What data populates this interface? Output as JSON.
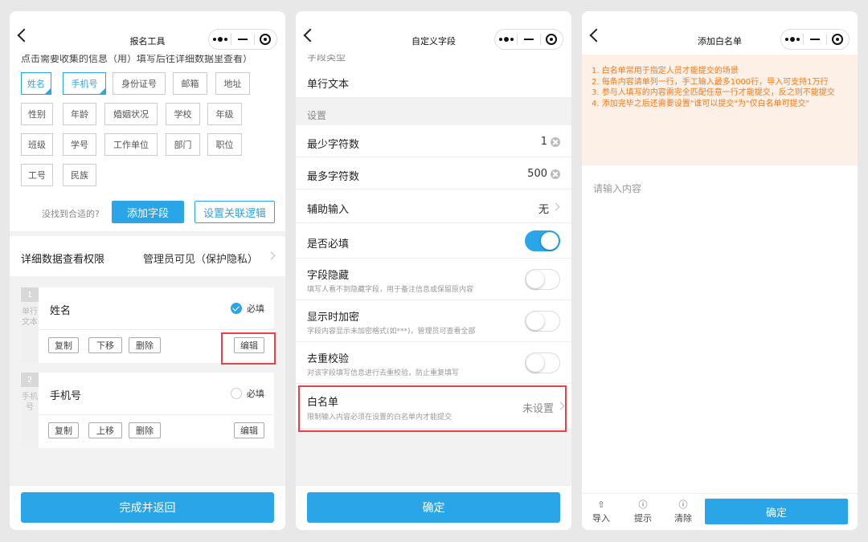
{
  "phone1": {
    "title": "报名工具",
    "cut_hint": "点击需要收集的信息（用）填写后往详细数据里查看）",
    "chips": [
      "姓名",
      "手机号",
      "身份证号",
      "邮箱",
      "地址",
      "性别",
      "年龄",
      "婚姻状况",
      "学校",
      "年级",
      "班级",
      "学号",
      "工作单位",
      "部门",
      "职位",
      "工号",
      "民族"
    ],
    "no_find": "没找到合适的?",
    "add_field": "添加字段",
    "set_logic": "设置关联逻辑",
    "perm_label": "详细数据查看权限",
    "perm_value": "管理员可见（保护隐私）",
    "fields": [
      {
        "num": "1",
        "type": "单行文本",
        "title": "姓名",
        "required": "必填",
        "actions": [
          "复制",
          "下移",
          "删除"
        ],
        "edit": "编辑"
      },
      {
        "num": "2",
        "type": "手机号",
        "title": "手机号",
        "required": "必填",
        "actions": [
          "复制",
          "上移",
          "删除"
        ],
        "edit": "编辑"
      }
    ],
    "done": "完成并返回"
  },
  "phone2": {
    "title": "自定义字段",
    "cut_label": "字段类型",
    "type_value": "单行文本",
    "section": "设置",
    "min_label": "最少字符数",
    "min_value": "1",
    "max_label": "最多字符数",
    "max_value": "500",
    "assist_label": "辅助输入",
    "assist_value": "无",
    "required_label": "是否必填",
    "hidden_label": "字段隐藏",
    "hidden_sub": "填写人看不到隐藏字段，用于备注信息或保留原内容",
    "encrypt_label": "显示时加密",
    "encrypt_sub": "字段内容显示未加密格式(如***)，管理员可查看全部",
    "dedup_label": "去重校验",
    "dedup_sub": "对该字段填写信息进行去重校验，防止重复填写",
    "whitelist_label": "白名单",
    "whitelist_sub": "限制输入内容必须在设置的白名单内才能提交",
    "whitelist_value": "未设置",
    "confirm": "确定"
  },
  "phone3": {
    "title": "添加白名单",
    "notice": [
      "1. 白名单常用于指定人员才能提交的场景",
      "2. 每条内容请单列一行，手工输入最多1000行，导入可支持1万行",
      "3. 参与人填写的内容需完全匹配任意一行才能提交，反之则不能提交",
      "4. 添加完毕之后还需要设置\"谁可以提交\"为\"仅白名单可提交\""
    ],
    "placeholder": "请输入内容",
    "import": "导入",
    "tips": "提示",
    "clear": "清除",
    "confirm": "确定"
  },
  "colors": {
    "accent": "#2aa5e8",
    "highlight": "#e8414b",
    "notice_text": "#f27a1a",
    "notice_bg": "#fdf0e6"
  },
  "icons": [
    "back-arrow-icon",
    "more-dots-icon",
    "minimize-icon",
    "close-target-icon",
    "checkmark-icon",
    "clear-icon",
    "chevron-right-icon",
    "upload-icon",
    "question-icon"
  ]
}
